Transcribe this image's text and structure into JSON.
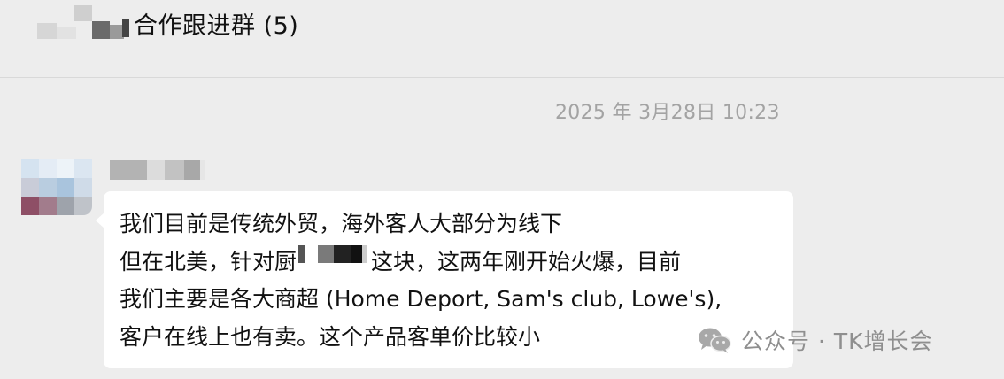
{
  "header": {
    "group_name": "合作跟进群 (5)"
  },
  "chat": {
    "timestamp": "2025 年 3月28日 10:23",
    "message": {
      "sender_redacted": true,
      "avatar_redacted": true,
      "lines": [
        "我们目前是传统外贸，海外客人大部分为线下",
        "但在北美，针对厨",
        "这块，这两年刚开始火爆，目前",
        "我们主要是各大商超 (Home Deport, Sam's club, Lowe's),",
        "客户在线上也有卖。这个产品客单价比较小"
      ]
    }
  },
  "watermark": {
    "text": "公众号 · TK增长会",
    "icon": "wechat-icon"
  },
  "colors": {
    "background": "#ededed",
    "bubble": "#ffffff",
    "text": "#111111",
    "timestamp": "#a3a3a3",
    "watermark": "#8f8f8f"
  }
}
